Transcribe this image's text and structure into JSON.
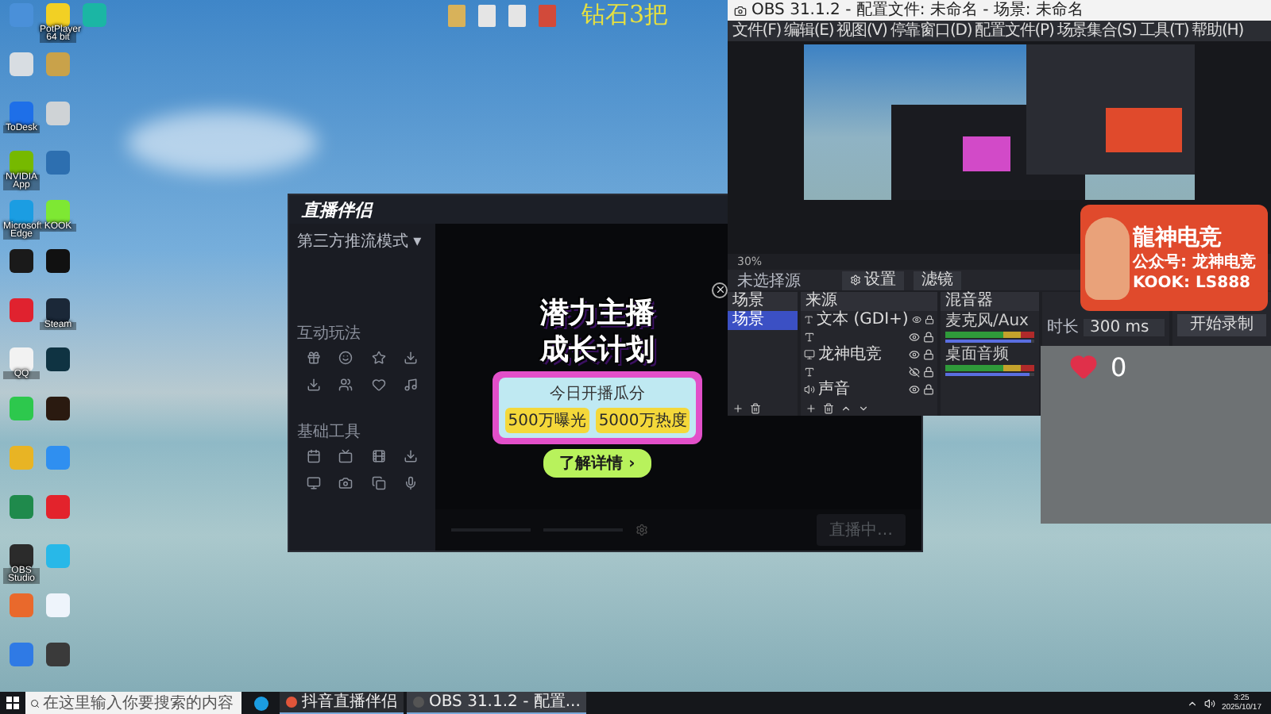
{
  "desktop": {
    "icons": [
      {
        "color": "#4a90d9"
      },
      {
        "color": "#d8dde2"
      },
      {
        "label": "ToDesk",
        "color": "#1e6fe8"
      },
      {
        "label": "NVIDIA App",
        "color": "#76b900"
      },
      {
        "label": "Microsoft Edge",
        "color": "#1b9de2"
      },
      {
        "color": "#1a1a1a"
      },
      {
        "color": "#e0222f"
      },
      {
        "label": "QQ",
        "color": "#f2f2f2"
      },
      {
        "color": "#2dc84d"
      },
      {
        "color": "#e8b424"
      },
      {
        "color": "#1f8a4c"
      },
      {
        "label": "OBS Studio",
        "color": "#2b2b2b"
      },
      {
        "color": "#e9692c"
      },
      {
        "color": "#2f7ae5"
      },
      {
        "label": "PotPlayer 64 bit",
        "color": "#f2d024"
      },
      {
        "color": "#c9a24a"
      },
      {
        "color": "#cfd3d6"
      },
      {
        "color": "#2d6fb0"
      },
      {
        "label": "KOOK",
        "color": "#7ee833"
      },
      {
        "color": "#111111"
      },
      {
        "label": "Steam",
        "color": "#1b2838"
      },
      {
        "color": "#0f3342"
      },
      {
        "color": "#2a1a10"
      },
      {
        "color": "#2f8ff0"
      },
      {
        "color": "#e3232c"
      },
      {
        "color": "#28b8e8"
      },
      {
        "color": "#eef4fb"
      },
      {
        "color": "#3a3a3a"
      },
      {
        "color": "#1bb6a4"
      }
    ],
    "overlay_text": "钻石3把"
  },
  "live_app": {
    "logo": "直播伴侣",
    "mode": "第三方推流模式 ▾",
    "sections": [
      "互动玩法",
      "基础工具"
    ],
    "status_button": "直播中…",
    "popup": {
      "title_lines": [
        "潜力主播",
        "成长计划"
      ],
      "subtitle": "今日开播瓜分",
      "rewards": [
        "500万曝光",
        "5000万热度"
      ],
      "button": "了解详情 ›"
    }
  },
  "obs": {
    "title": "OBS 31.1.2 - 配置文件: 未命名 - 场景: 未命名",
    "menu": [
      "文件(F)",
      "编辑(E)",
      "视图(V)",
      "停靠窗口(D)",
      "配置文件(P)",
      "场景集合(S)",
      "工具(T)",
      "帮助(H)"
    ],
    "zoom": "30%",
    "no_source": "未选择源",
    "dock_buttons": [
      "设置",
      "滤镜"
    ],
    "scenes": {
      "title": "场景",
      "items": [
        {
          "name": "场景",
          "selected": true
        }
      ]
    },
    "sources": {
      "title": "来源",
      "items": [
        {
          "name": "文本 (GDI+)",
          "kind": "text",
          "visible": true
        },
        {
          "kind": "text",
          "visible": true
        },
        {
          "name": "龙神电竞",
          "kind": "window",
          "visible": true
        },
        {
          "kind": "text",
          "visible": false
        },
        {
          "name": "声音",
          "kind": "audio",
          "visible": true
        }
      ]
    },
    "mixer": {
      "title": "混音器",
      "channels": [
        {
          "name": "麦克风/Aux",
          "level": 0.97
        },
        {
          "name": "桌面音频",
          "level": 0.95
        }
      ]
    },
    "transition": {
      "duration_label": "时长",
      "duration": "300 ms"
    },
    "controls": {
      "record_button": "开始录制"
    }
  },
  "overlay_card": {
    "title": "龍神电竞",
    "lines": [
      "公众号: 龙神电竞",
      "KOOK: LS888"
    ]
  },
  "heart_widget": {
    "count": "0"
  },
  "taskbar": {
    "search_placeholder": "在这里输入你要搜索的内容",
    "apps": [
      {
        "label": "抖音直播伴侣",
        "selected": false
      },
      {
        "label": "OBS 31.1.2 - 配置...",
        "selected": true
      }
    ],
    "time": "3:25",
    "date": "2025/10/17"
  }
}
